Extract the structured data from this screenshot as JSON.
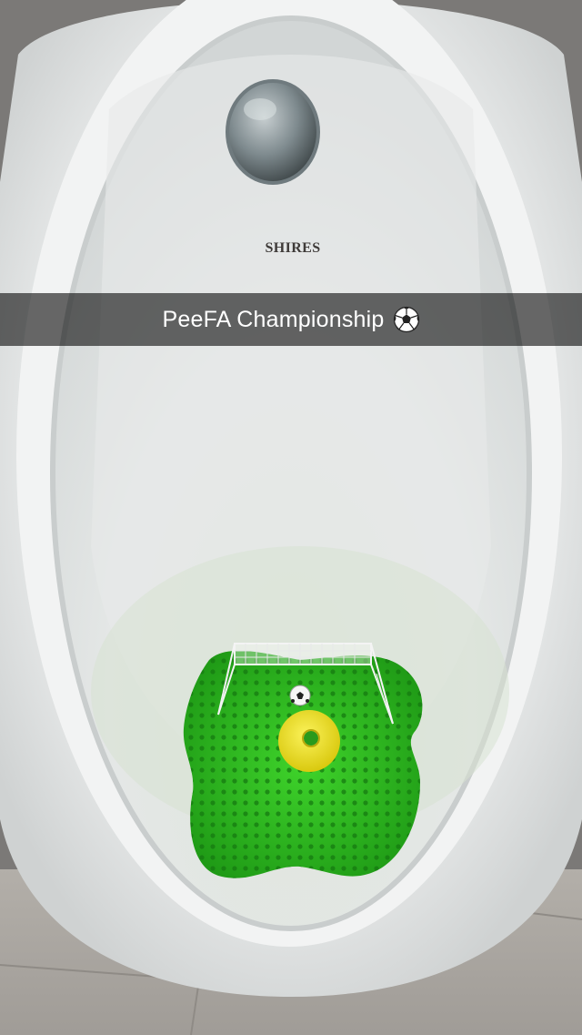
{
  "caption": {
    "text": "PeeFA Championship",
    "emoji": "soccer-ball-icon"
  },
  "brand": {
    "text": "SHIRES"
  },
  "colors": {
    "urinal_white": "#eceeee",
    "screen_green": "#2fbf1e",
    "ring_yellow": "#f2e41a",
    "caption_overlay": "rgba(0,0,0,0.58)",
    "floor": "#a9a5a0",
    "wall": "#7f7d7b"
  }
}
